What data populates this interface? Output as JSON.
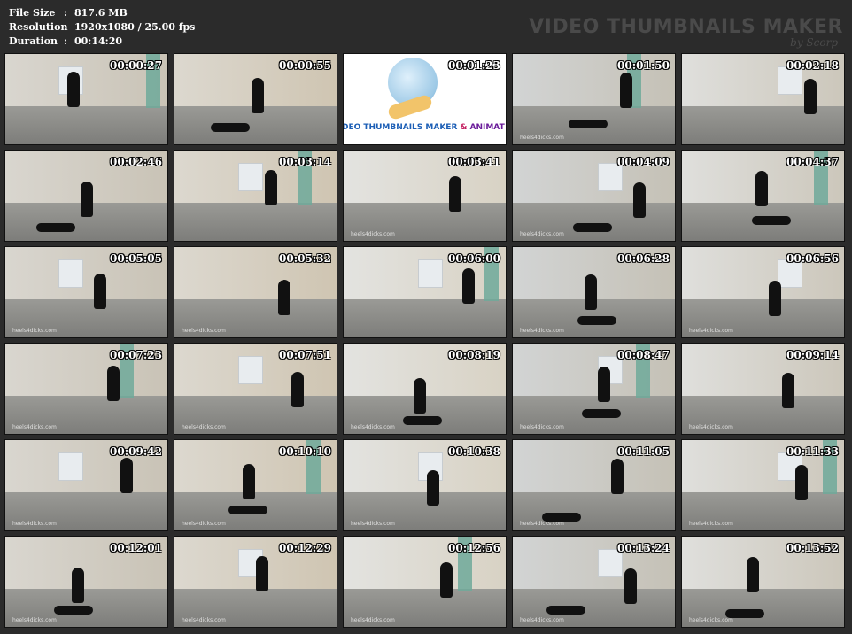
{
  "header": {
    "file_size_label": "File Size",
    "file_size_value": "817.6 MB",
    "resolution_label": "Resolution",
    "resolution_value": "1920x1080 / 25.00 fps",
    "duration_label": "Duration",
    "duration_value": "00:14:20",
    "separator": ":",
    "brand_title": "VIDEO THUMBNAILS MAKER",
    "brand_sub": "by Scorp"
  },
  "logo": {
    "text_start": "DEO THUMBNAILS MAKER ",
    "text_amp": "&",
    "text_tail": " ANIMAT"
  },
  "thumbnails": [
    {
      "time": "00:00:27",
      "watermark": ""
    },
    {
      "time": "00:00:55",
      "watermark": ""
    },
    {
      "time": "00:01:23",
      "watermark": ""
    },
    {
      "time": "00:01:50",
      "watermark": "heels4dicks.com"
    },
    {
      "time": "00:02:18",
      "watermark": ""
    },
    {
      "time": "00:02:46",
      "watermark": ""
    },
    {
      "time": "00:03:14",
      "watermark": ""
    },
    {
      "time": "00:03:41",
      "watermark": "heels4dicks.com"
    },
    {
      "time": "00:04:09",
      "watermark": "heels4dicks.com"
    },
    {
      "time": "00:04:37",
      "watermark": ""
    },
    {
      "time": "00:05:05",
      "watermark": "heels4dicks.com"
    },
    {
      "time": "00:05:32",
      "watermark": "heels4dicks.com"
    },
    {
      "time": "00:06:00",
      "watermark": ""
    },
    {
      "time": "00:06:28",
      "watermark": "heels4dicks.com"
    },
    {
      "time": "00:06:56",
      "watermark": "heels4dicks.com"
    },
    {
      "time": "00:07:23",
      "watermark": "heels4dicks.com"
    },
    {
      "time": "00:07:51",
      "watermark": "heels4dicks.com"
    },
    {
      "time": "00:08:19",
      "watermark": "heels4dicks.com"
    },
    {
      "time": "00:08:47",
      "watermark": "heels4dicks.com"
    },
    {
      "time": "00:09:14",
      "watermark": "heels4dicks.com"
    },
    {
      "time": "00:09:42",
      "watermark": "heels4dicks.com"
    },
    {
      "time": "00:10:10",
      "watermark": "heels4dicks.com"
    },
    {
      "time": "00:10:38",
      "watermark": "heels4dicks.com"
    },
    {
      "time": "00:11:05",
      "watermark": "heels4dicks.com"
    },
    {
      "time": "00:11:33",
      "watermark": "heels4dicks.com"
    },
    {
      "time": "00:12:01",
      "watermark": "heels4dicks.com"
    },
    {
      "time": "00:12:29",
      "watermark": "heels4dicks.com"
    },
    {
      "time": "00:12:56",
      "watermark": "heels4dicks.com"
    },
    {
      "time": "00:13:24",
      "watermark": "heels4dicks.com"
    },
    {
      "time": "00:13:52",
      "watermark": "heels4dicks.com"
    }
  ]
}
